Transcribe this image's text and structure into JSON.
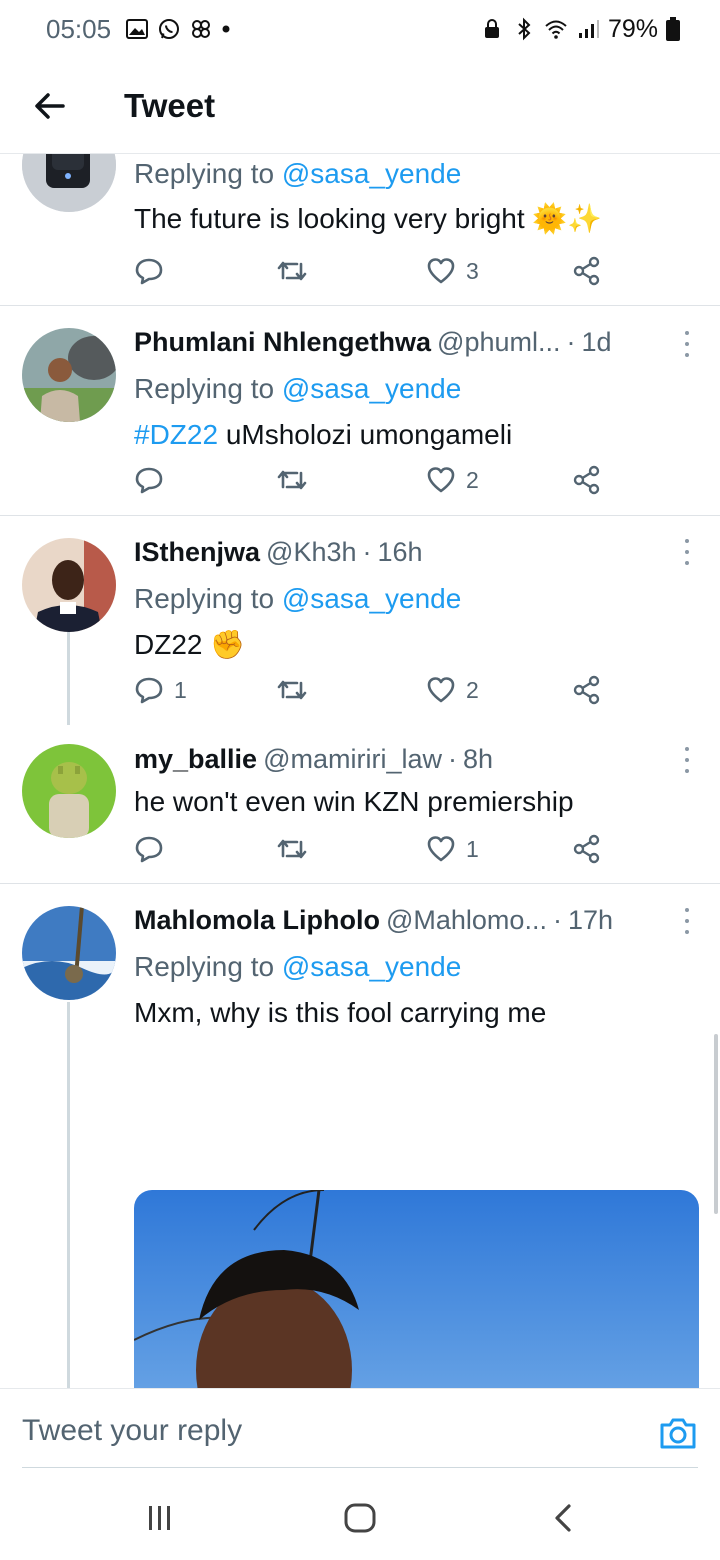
{
  "status_bar": {
    "time": "05:05",
    "battery": "79%",
    "icons": [
      "gallery-icon",
      "whatsapp-icon",
      "pinwheel-icon",
      "dot-icon",
      "lock-icon",
      "bluetooth-icon",
      "wifi-icon",
      "signal-icon",
      "battery-icon"
    ]
  },
  "header": {
    "title": "Tweet",
    "back_icon": "arrow-left-icon"
  },
  "tweets": [
    {
      "name": "",
      "handle": "",
      "time": "",
      "replying_prefix": "Replying to ",
      "replying_to": "@sasa_yende",
      "text": "The future  is looking very bright 🌞✨",
      "replies": "",
      "likes": "3"
    },
    {
      "name": "Phumlani Nhlengethwa",
      "handle": "@phuml...",
      "time": "1d",
      "replying_prefix": "Replying to ",
      "replying_to": "@sasa_yende",
      "hashtag": "#DZ22",
      "text": " uMsholozi umongameli",
      "replies": "",
      "likes": "2"
    },
    {
      "name": "ISthenjwa",
      "handle": "@Kh3h",
      "time": "16h",
      "replying_prefix": "Replying to ",
      "replying_to": "@sasa_yende",
      "text": "DZ22 ✊",
      "replies": "1",
      "likes": "2"
    },
    {
      "name": "my_ballie",
      "handle": "@mamiriri_law",
      "time": "8h",
      "text": "he won't even win KZN premiership",
      "replies": "",
      "likes": "1"
    },
    {
      "name": "Mahlomola Lipholo",
      "handle": "@Mahlomo...",
      "time": "17h",
      "replying_prefix": "Replying to ",
      "replying_to": "@sasa_yende",
      "text": "Mxm, why is this fool carrying me"
    }
  ],
  "separator": "·",
  "reply_bar": {
    "placeholder": "Tweet your reply",
    "camera_icon": "camera-icon"
  },
  "nav_bar": {
    "icons": [
      "recent-apps-icon",
      "home-icon",
      "back-icon"
    ]
  },
  "colors": {
    "accent": "#1d9bf0",
    "text_primary": "#0f1419",
    "text_secondary": "#536471"
  }
}
